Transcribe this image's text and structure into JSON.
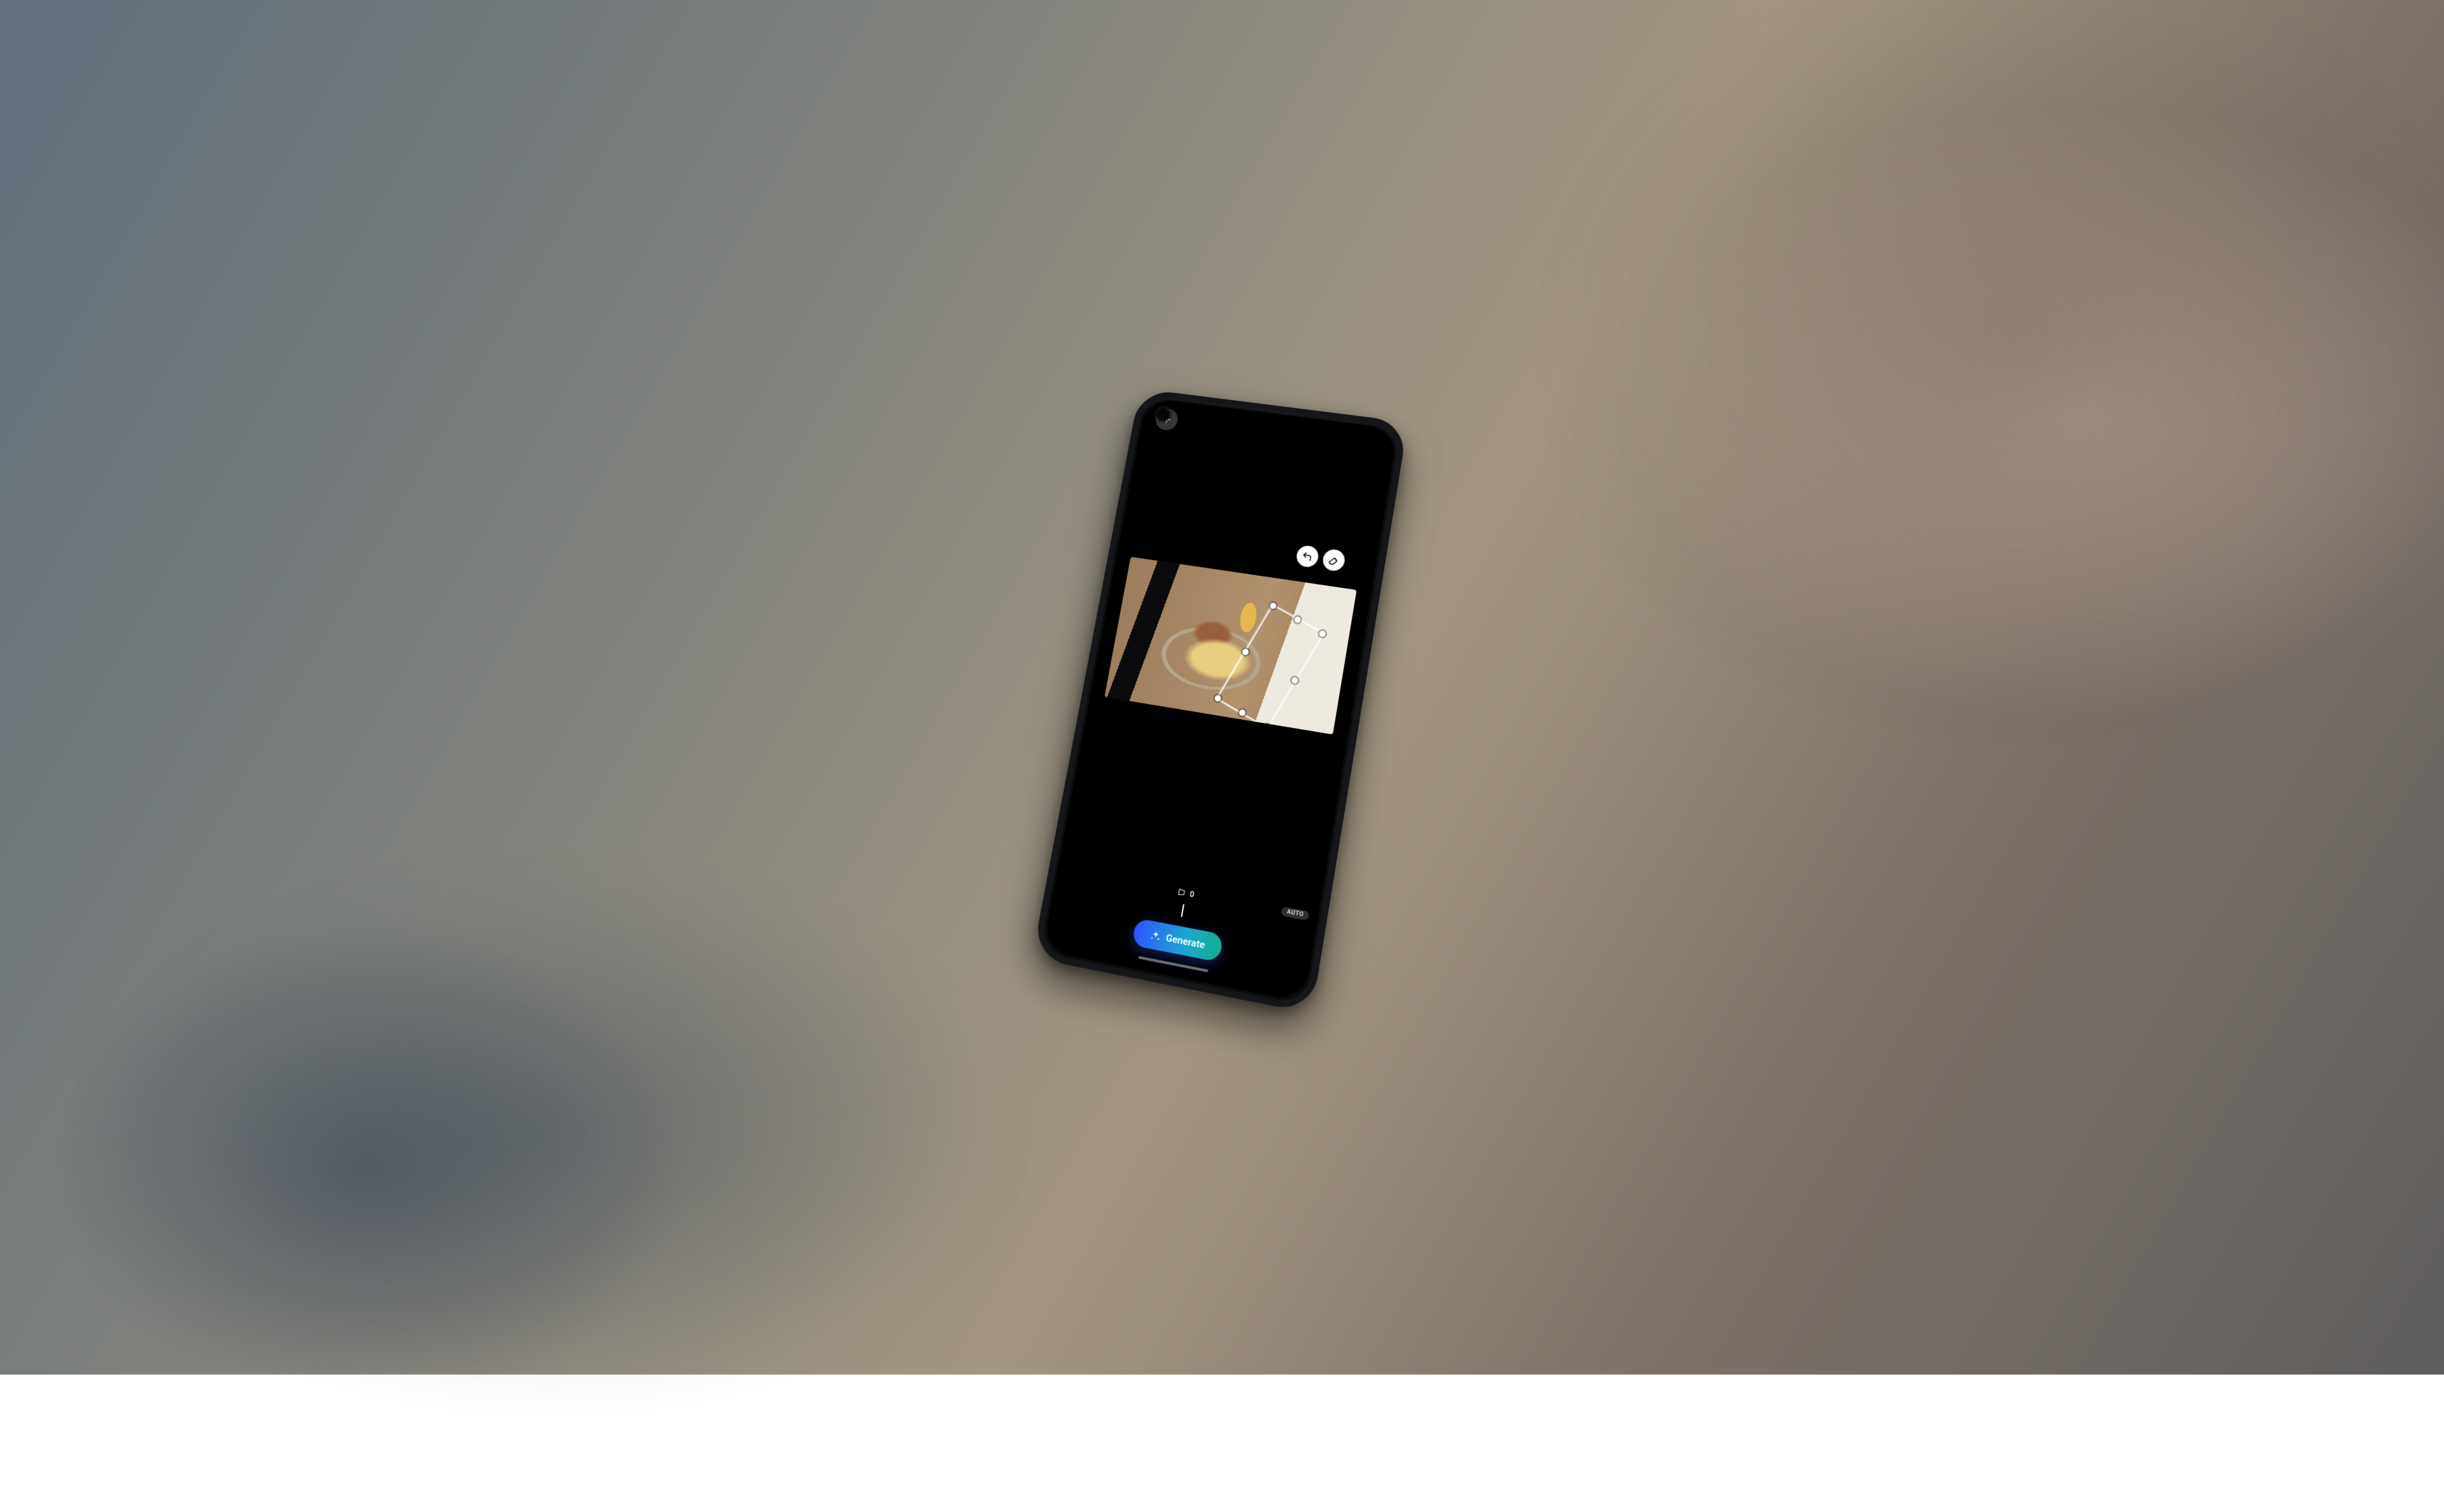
{
  "context": {
    "description": "Photograph of a person holding a smartphone; the phone screen shows an AI image-editing app with a food photo loaded and a generative-fill selection drawn.",
    "phone_orientation": "portrait, tilted"
  },
  "app": {
    "topbar": {
      "add_icon": "plus-icon"
    },
    "canvas": {
      "image_subject": "plate of food (mashed potato + meat) on wooden table with a glass of beer, a smartphone and a paper menu",
      "selection_shape": "rotated-rectangle",
      "floating_tools": {
        "undo_icon": "undo-icon",
        "erase_icon": "eraser-icon"
      }
    },
    "bottom": {
      "slider_icon": "perspective-icon",
      "slider_value": "0",
      "auto_label": "AUTO",
      "generate_icon": "sparkle-icon",
      "generate_label": "Generate"
    }
  }
}
